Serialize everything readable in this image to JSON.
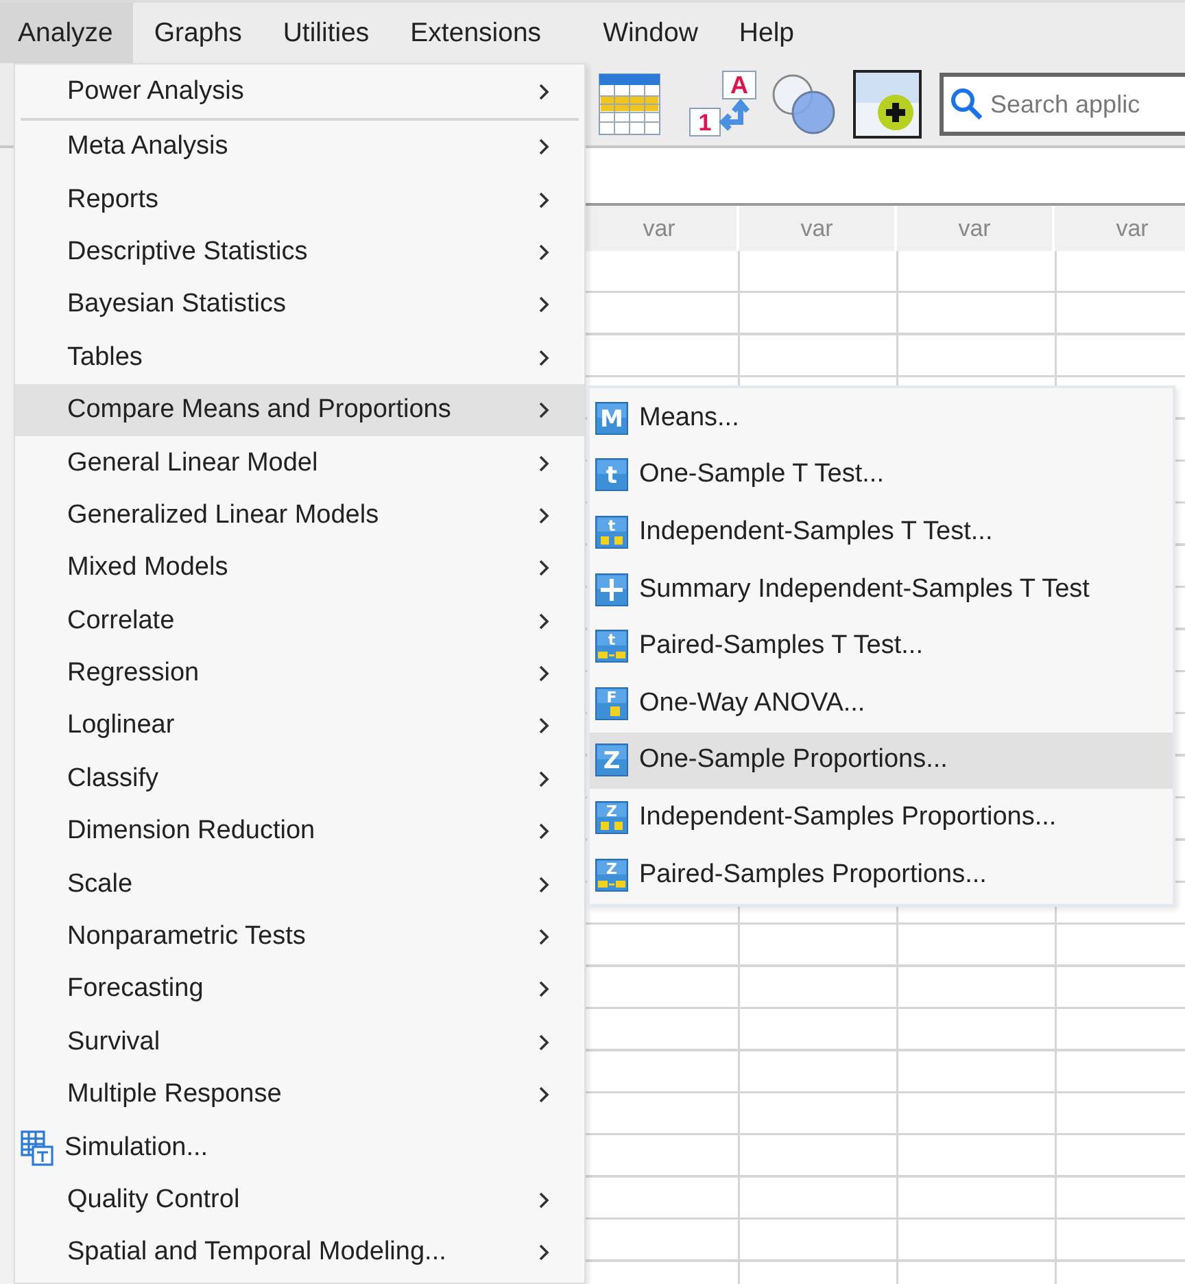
{
  "menubar": [
    {
      "label": "Analyze",
      "selected": true
    },
    {
      "label": "Graphs",
      "selected": false
    },
    {
      "label": "Utilities",
      "selected": false
    },
    {
      "label": "Extensions",
      "selected": false
    },
    {
      "label": "Window",
      "selected": false
    },
    {
      "label": "Help",
      "selected": false
    }
  ],
  "toolbar": {
    "variable_marks": {
      "string": "A",
      "numeric": "1"
    },
    "search": {
      "placeholder": "Search applic"
    }
  },
  "grid": {
    "columns": [
      "var",
      "var",
      "var",
      "var"
    ]
  },
  "menu": {
    "groups": [
      {
        "items": [
          {
            "label": "Power Analysis",
            "kind": "submenu",
            "selected": false
          }
        ]
      },
      {
        "items": [
          {
            "label": "Meta Analysis",
            "kind": "submenu",
            "selected": false
          },
          {
            "label": "Reports",
            "kind": "submenu",
            "selected": false
          },
          {
            "label": "Descriptive Statistics",
            "kind": "submenu",
            "selected": false
          },
          {
            "label": "Bayesian Statistics",
            "kind": "submenu",
            "selected": false
          },
          {
            "label": "Tables",
            "kind": "submenu",
            "selected": false
          },
          {
            "label": "Compare Means and Proportions",
            "kind": "submenu",
            "selected": true
          },
          {
            "label": "General Linear Model",
            "kind": "submenu",
            "selected": false
          },
          {
            "label": "Generalized Linear Models",
            "kind": "submenu",
            "selected": false
          },
          {
            "label": "Mixed Models",
            "kind": "submenu",
            "selected": false
          },
          {
            "label": "Correlate",
            "kind": "submenu",
            "selected": false
          },
          {
            "label": "Regression",
            "kind": "submenu",
            "selected": false
          },
          {
            "label": "Loglinear",
            "kind": "submenu",
            "selected": false
          },
          {
            "label": "Classify",
            "kind": "submenu",
            "selected": false
          },
          {
            "label": "Dimension Reduction",
            "kind": "submenu",
            "selected": false
          },
          {
            "label": "Scale",
            "kind": "submenu",
            "selected": false
          },
          {
            "label": "Nonparametric Tests",
            "kind": "submenu",
            "selected": false
          },
          {
            "label": "Forecasting",
            "kind": "submenu",
            "selected": false
          },
          {
            "label": "Survival",
            "kind": "submenu",
            "selected": false
          },
          {
            "label": "Multiple Response",
            "kind": "submenu",
            "selected": false
          },
          {
            "label": "Simulation...",
            "kind": "command",
            "selected": false
          },
          {
            "label": "Quality Control",
            "kind": "submenu",
            "selected": false
          },
          {
            "label": "Spatial and Temporal Modeling...",
            "kind": "submenu",
            "selected": false
          }
        ]
      }
    ]
  },
  "submenu": {
    "items": [
      {
        "label": "Means...",
        "badge": "M",
        "kind": "plain",
        "selected": false
      },
      {
        "label": "One-Sample T Test...",
        "badge": "t",
        "kind": "plain",
        "selected": false
      },
      {
        "label": "Independent-Samples T Test...",
        "badge": "t",
        "kind": "two-groups",
        "selected": false
      },
      {
        "label": "Summary Independent-Samples T Test",
        "kind": "plus",
        "selected": false
      },
      {
        "label": "Paired-Samples T Test...",
        "badge": "t",
        "kind": "paired",
        "selected": false
      },
      {
        "label": "One-Way ANOVA...",
        "badge": "F",
        "kind": "one-group",
        "selected": false
      },
      {
        "label": "One-Sample Proportions...",
        "badge": "Z",
        "kind": "plain",
        "selected": true
      },
      {
        "label": "Independent-Samples Proportions...",
        "badge": "Z",
        "kind": "two-groups",
        "selected": false
      },
      {
        "label": "Paired-Samples Proportions...",
        "badge": "Z",
        "kind": "paired",
        "selected": false
      }
    ]
  }
}
